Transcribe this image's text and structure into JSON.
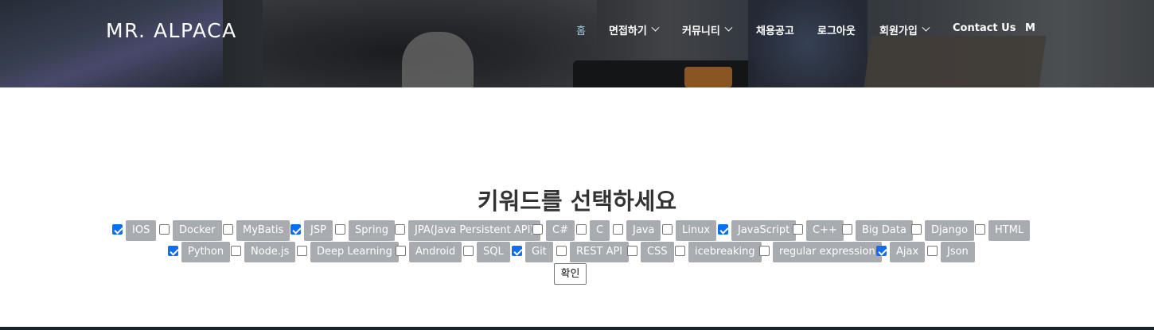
{
  "header": {
    "brand": "MR. ALPACA",
    "nav": [
      {
        "label": "홈",
        "dropdown": false,
        "active": true
      },
      {
        "label": "면접하기",
        "dropdown": true,
        "active": false
      },
      {
        "label": "커뮤니티",
        "dropdown": true,
        "active": false
      },
      {
        "label": "채용공고",
        "dropdown": false,
        "active": false
      },
      {
        "label": "로그아웃",
        "dropdown": false,
        "active": false
      },
      {
        "label": "회원가입",
        "dropdown": true,
        "active": false
      },
      {
        "label": "Contact Us",
        "dropdown": false,
        "active": false
      },
      {
        "label": "M",
        "dropdown": false,
        "active": false
      }
    ]
  },
  "main": {
    "title": "키워드를 선택하세요",
    "keywords": [
      {
        "label": "IOS",
        "checked": true
      },
      {
        "label": "Docker",
        "checked": false
      },
      {
        "label": "MyBatis",
        "checked": false
      },
      {
        "label": "JSP",
        "checked": true
      },
      {
        "label": "Spring",
        "checked": false
      },
      {
        "label": "JPA(Java Persistent API)",
        "checked": false
      },
      {
        "label": "C#",
        "checked": false
      },
      {
        "label": "C",
        "checked": false
      },
      {
        "label": "Java",
        "checked": false
      },
      {
        "label": "Linux",
        "checked": false
      },
      {
        "label": "JavaScript",
        "checked": true
      },
      {
        "label": "C++",
        "checked": false
      },
      {
        "label": "Big Data",
        "checked": false
      },
      {
        "label": "Django",
        "checked": false
      },
      {
        "label": "HTML",
        "checked": false
      },
      {
        "label": "Python",
        "checked": true
      },
      {
        "label": "Node.js",
        "checked": false
      },
      {
        "label": "Deep Learning",
        "checked": false
      },
      {
        "label": "Android",
        "checked": false
      },
      {
        "label": "SQL",
        "checked": false
      },
      {
        "label": "Git",
        "checked": true
      },
      {
        "label": "REST API",
        "checked": false
      },
      {
        "label": "CSS",
        "checked": false
      },
      {
        "label": "icebreaking",
        "checked": false
      },
      {
        "label": "regular expression",
        "checked": false
      },
      {
        "label": "Ajax",
        "checked": true
      },
      {
        "label": "Json",
        "checked": false
      }
    ],
    "confirm_label": "확인"
  },
  "colors": {
    "tag_bg": "#a8abb0",
    "check_on": "#0b6ef3",
    "nav_active": "#9ec3de"
  }
}
